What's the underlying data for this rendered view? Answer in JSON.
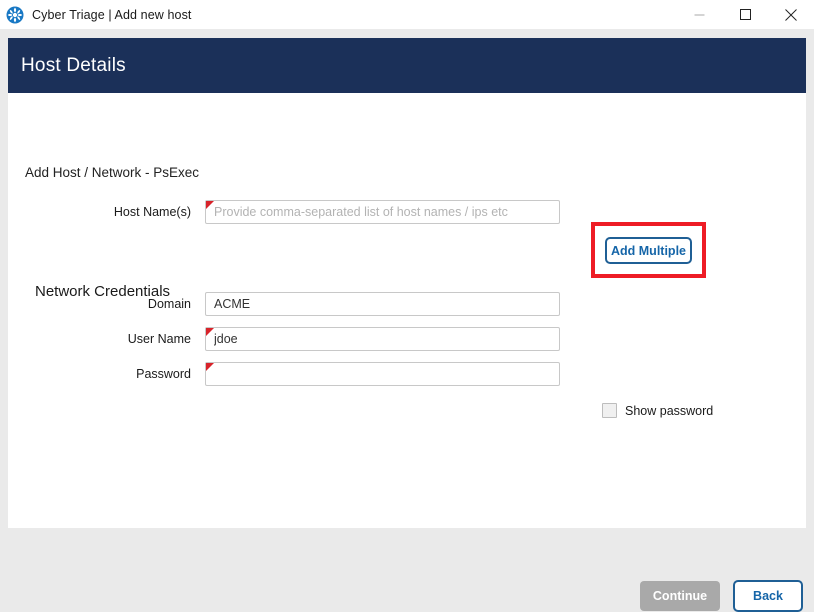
{
  "window": {
    "title": "Cyber Triage | Add new host",
    "logo_icon": "cyber-triage-logo-icon",
    "controls": {
      "minimize": "minimize-icon",
      "maximize": "maximize-icon",
      "close": "close-icon"
    }
  },
  "dialog": {
    "header_title": "Host Details",
    "breadcrumb": "Add Host / Network - PsExec",
    "section_title": "Network Credentials"
  },
  "form": {
    "host_names": {
      "label": "Host Name(s)",
      "value": "",
      "placeholder": "Provide comma-separated list of host names / ips etc",
      "required": true
    },
    "domain": {
      "label": "Domain",
      "value": "ACME",
      "placeholder": "",
      "required": false
    },
    "user_name": {
      "label": "User Name",
      "value": "jdoe",
      "placeholder": "",
      "required": true
    },
    "password": {
      "label": "Password",
      "value": "",
      "placeholder": "",
      "required": true
    }
  },
  "actions": {
    "add_multiple": "Add Multiple",
    "show_password": "Show password",
    "continue": "Continue",
    "back": "Back"
  },
  "colors": {
    "header_navy": "#1b3059",
    "accent_blue": "#1565a8",
    "annotation_red": "#ee1c25",
    "required_marker_red": "#d8232a",
    "disabled_gray": "#a9a9a9",
    "page_background": "#eaeaea"
  }
}
